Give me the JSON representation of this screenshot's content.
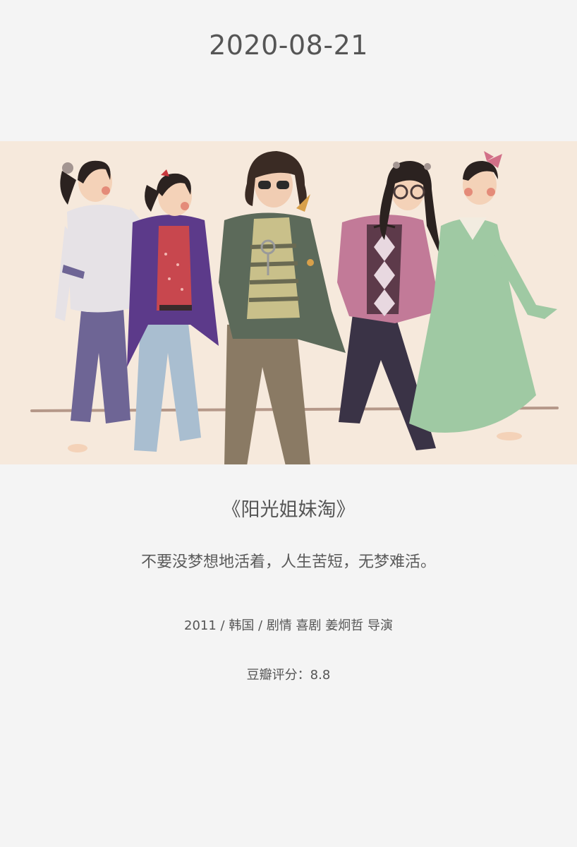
{
  "card": {
    "date": "2020-08-21",
    "title": "《阳光姐妹淘》",
    "quote": "不要没梦想地活着，人生苦短，无梦难活。",
    "meta": "2011 / 韩国 / 剧情 喜剧 姜炯哲 导演",
    "rating": "豆瓣评分：8.8"
  },
  "illustration": {
    "description_icon": "five-girls-dancing-illustration-icon",
    "colors": {
      "background": "#f6e9dc",
      "floor_line": "#b59889"
    }
  }
}
